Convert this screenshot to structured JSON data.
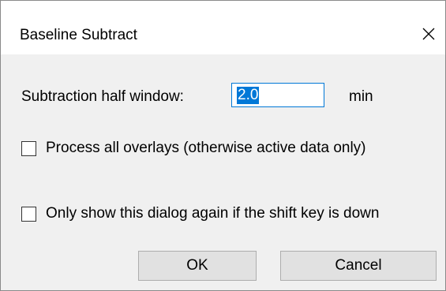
{
  "window": {
    "title": "Baseline Subtract",
    "close_icon": "close-icon"
  },
  "form": {
    "half_window_label": "Subtraction half window:",
    "half_window_value": "2.0",
    "half_window_unit": "min",
    "process_all_label": "Process all overlays (otherwise active data only)",
    "process_all_checked": false,
    "shift_key_label": "Only show this dialog again if the shift key is down",
    "shift_key_checked": false
  },
  "buttons": {
    "ok_label": "OK",
    "cancel_label": "Cancel"
  },
  "colors": {
    "accent": "#0078d7",
    "dialog_background": "#f0f0f0",
    "titlebar_background": "#ffffff",
    "button_background": "#e1e1e1"
  }
}
